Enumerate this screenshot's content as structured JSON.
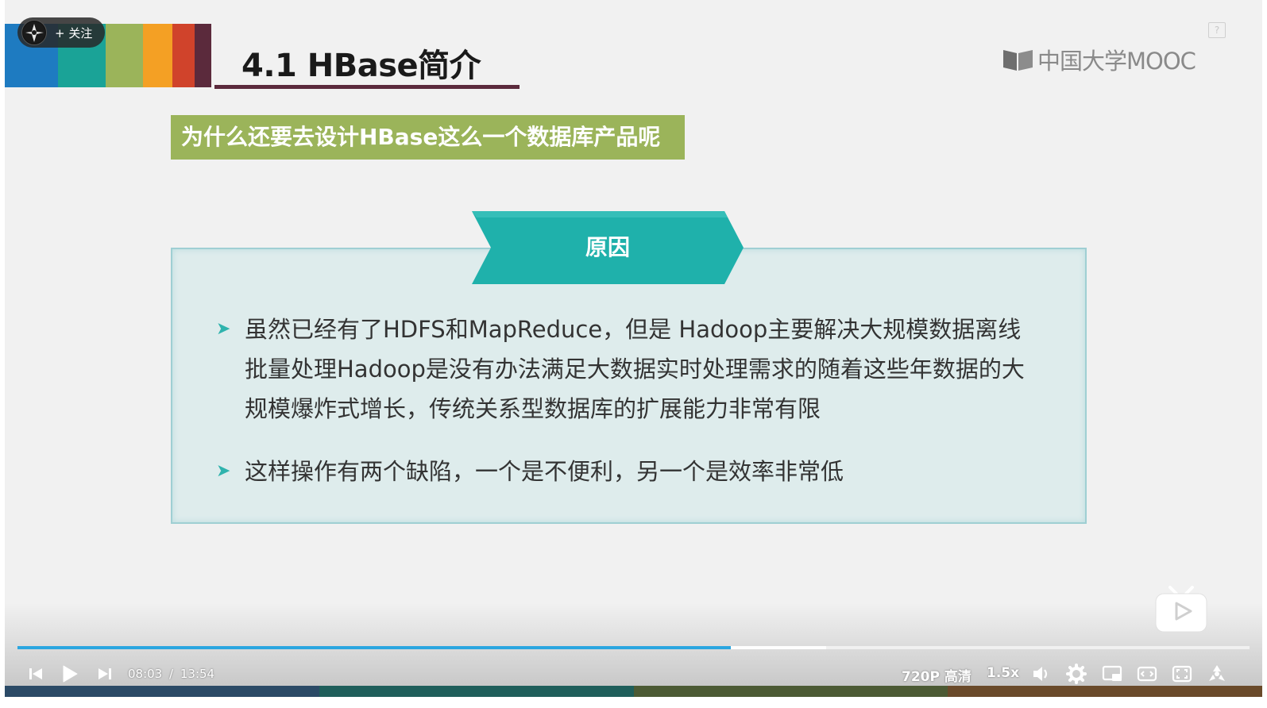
{
  "header": {
    "title": "4.1 HBase简介",
    "band_colors": [
      "#1e7bc1",
      "#1aa397",
      "#9bb45a",
      "#f4a024",
      "#d0432b",
      "#5b2a3c"
    ]
  },
  "follow": {
    "label": "+ 关注"
  },
  "logo": {
    "text": "中国大学MOOC"
  },
  "help": {
    "label": "?"
  },
  "subtitle": "为什么还要去设计HBase这么一个数据库产品呢",
  "panel": {
    "banner": "原因",
    "bullets": [
      {
        "lines": [
          "虽然已经有了HDFS和MapReduce，但是 Hadoop主要解决大规模数据离线",
          "批量处理Hadoop是没有办法满足大数据实时处理需求的随着这些年数据的大",
          "规模爆炸式增长，传统关系型数据库的扩展能力非常有限"
        ]
      },
      {
        "lines": [
          "这样操作有两个缺陷，一个是不便利，另一个是效率非常低"
        ]
      }
    ]
  },
  "player": {
    "current_time": "08:03",
    "separator": "/",
    "duration": "13:54",
    "progress": 0.579,
    "quality": "720P 高清",
    "speed": "1.5x",
    "accent": "#2ba6e0",
    "icons": [
      "prev-icon",
      "play-icon",
      "next-icon",
      "volume-icon",
      "settings-icon",
      "pip-icon",
      "widescreen-icon",
      "web-fullscreen-icon",
      "fullscreen-icon"
    ]
  }
}
